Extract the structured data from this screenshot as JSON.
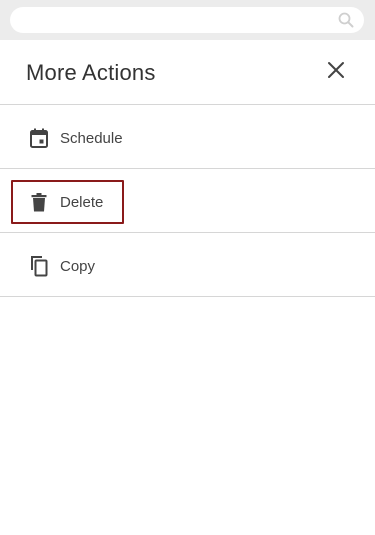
{
  "header": {
    "title": "More Actions"
  },
  "actions": [
    {
      "label": "Schedule",
      "icon": "calendar-icon"
    },
    {
      "label": "Delete",
      "icon": "trash-icon",
      "selected": true
    },
    {
      "label": "Copy",
      "icon": "copy-icon"
    }
  ],
  "colors": {
    "selected_border": "#8a1a1a",
    "icon": "#444444",
    "divider": "#d6d6d6"
  }
}
